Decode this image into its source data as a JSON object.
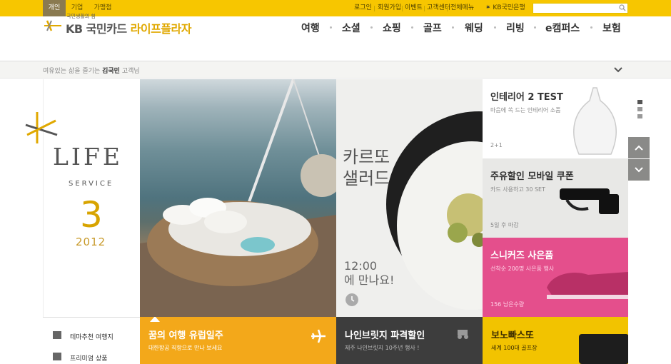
{
  "top_tabs": [
    "개인",
    "기업",
    "가맹점"
  ],
  "utility_links": [
    "로그인",
    "회원가입",
    "이벤트",
    "고객센터",
    "전체메뉴"
  ],
  "bank_link": "KB국민은행",
  "search": {
    "placeholder": ""
  },
  "logo": {
    "tagline": "국민생활의 힘",
    "brand": "KB 국민카드",
    "product": "라이프플라자"
  },
  "nav": [
    "여행",
    "소셜",
    "쇼핑",
    "골프",
    "웨딩",
    "리빙",
    "e캠퍼스",
    "보험"
  ],
  "greeting": {
    "prefix": "여유있는 삶을 즐기는",
    "name": "김국민",
    "suffix": "고객님"
  },
  "hero": {
    "title": "LIFE",
    "subtitle": "SERVICE",
    "month": "3",
    "year": "2012"
  },
  "left_menu": [
    "테마추천 여행지",
    "프리미엄 상품"
  ],
  "salad": {
    "title_line1": "카르또",
    "title_line2": "샐러드",
    "time": "12:00",
    "time_sub": "에 만나요!"
  },
  "tiles": [
    {
      "title": "인테리어 2 TEST",
      "sub": "마음에 쏙 드는 인테리어 소품",
      "foot": "2+1"
    },
    {
      "title": "주유할인 모바일 쿠폰",
      "sub": "카드 사용하고 30 SET",
      "foot": "5일 후 마감"
    },
    {
      "title": "스니커즈 사은품",
      "sub": "선착순 200명 사은품 행사",
      "foot": "156 남은수량"
    }
  ],
  "bottom_tiles": [
    {
      "title": "꿈의 여행 유럽일주",
      "sub": "대한항공 직항으로 만나 보세요"
    },
    {
      "title": "나인브릿지 파격할인",
      "sub": "제주 나인브릿지 10주년 행사 !"
    },
    {
      "title": "보노빠스또",
      "sub": "세계 100대 골프장"
    }
  ],
  "colors": {
    "brand_yellow": "#f7c600",
    "gold": "#d8a400",
    "pink": "#e44f8c",
    "orange": "#f3a81a"
  }
}
